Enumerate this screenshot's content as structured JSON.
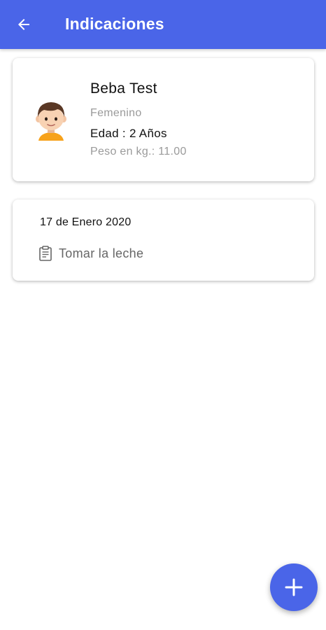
{
  "appbar": {
    "title": "Indicaciones",
    "back_icon": "arrow-back-icon",
    "background": "#4a65e8"
  },
  "profile": {
    "name": "Beba Test",
    "gender": "Femenino",
    "age": "Edad : 2 Años",
    "weight": "Peso en kg.: 11.00",
    "avatar_icon": "child-avatar-icon"
  },
  "note": {
    "date": "17 de Enero 2020",
    "icon": "clipboard-icon",
    "text": "Tomar la leche"
  },
  "fab": {
    "icon": "add-icon",
    "color": "#4a65e8"
  }
}
